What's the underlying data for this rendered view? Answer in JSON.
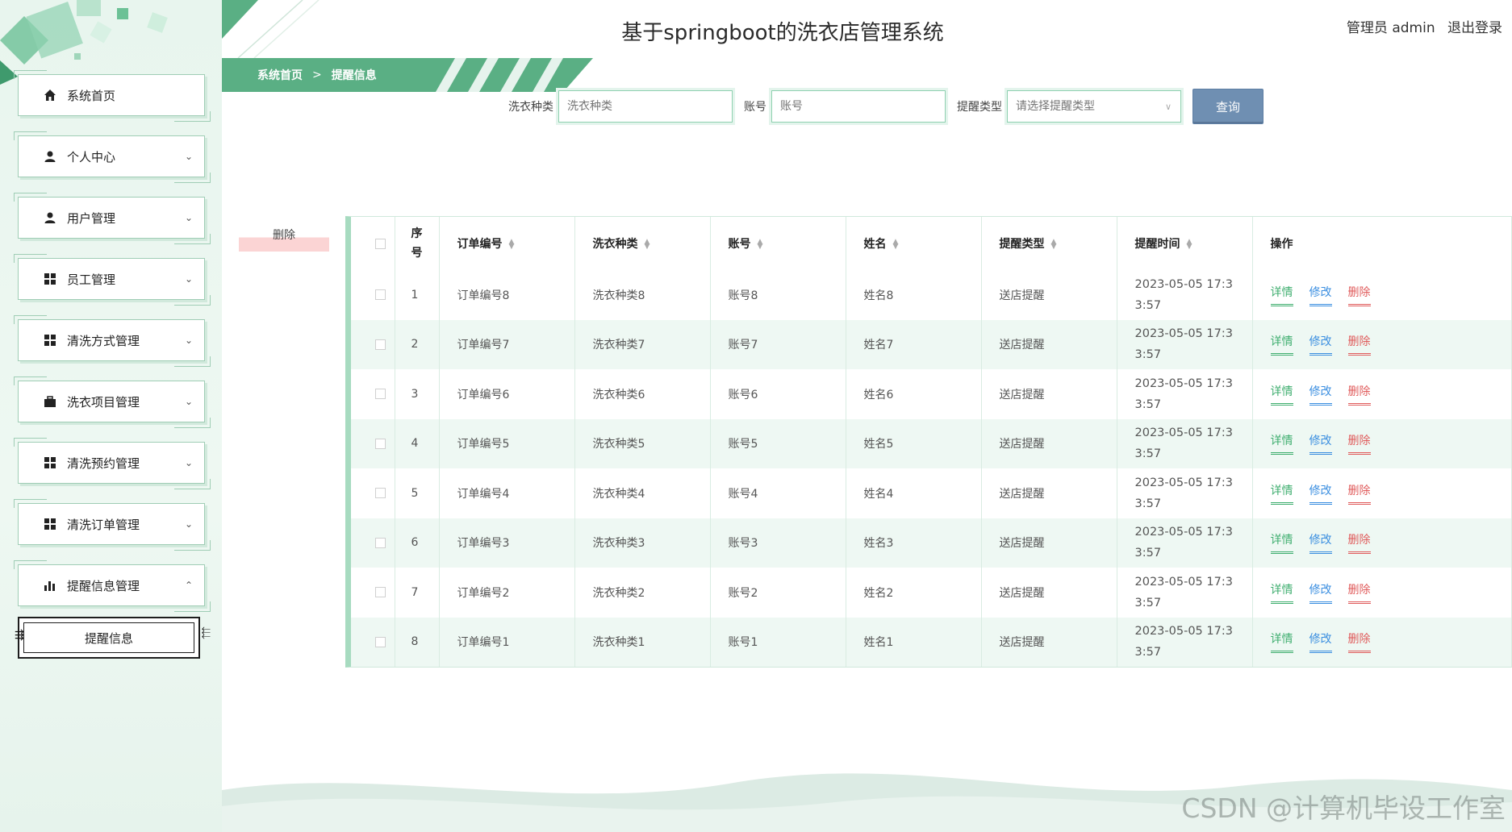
{
  "app": {
    "title": "基于springboot的洗衣店管理系统"
  },
  "header": {
    "user": "管理员 admin",
    "logout": "退出登录"
  },
  "breadcrumb": {
    "home": "系统首页",
    "separator": ">",
    "current": "提醒信息"
  },
  "sidebar": {
    "items": [
      {
        "label": "系统首页",
        "icon": "home-icon"
      },
      {
        "label": "个人中心",
        "icon": "user-icon",
        "chevron": "⌄"
      },
      {
        "label": "用户管理",
        "icon": "user-icon",
        "chevron": "⌄"
      },
      {
        "label": "员工管理",
        "icon": "grid-icon",
        "chevron": "⌄"
      },
      {
        "label": "清洗方式管理",
        "icon": "grid-icon",
        "chevron": "⌄"
      },
      {
        "label": "洗衣项目管理",
        "icon": "briefcase-icon",
        "chevron": "⌄"
      },
      {
        "label": "清洗预约管理",
        "icon": "grid-icon",
        "chevron": "⌄"
      },
      {
        "label": "清洗订单管理",
        "icon": "grid-icon",
        "chevron": "⌄"
      },
      {
        "label": "提醒信息管理",
        "icon": "bar-chart-icon",
        "chevron": "⌃"
      }
    ],
    "sub_item": {
      "label": "提醒信息"
    }
  },
  "search": {
    "laundry_type_label": "洗衣种类",
    "laundry_type_placeholder": "洗衣种类",
    "account_label": "账号",
    "account_placeholder": "账号",
    "reminder_type_label": "提醒类型",
    "reminder_type_placeholder": "请选择提醒类型",
    "query_button": "查询"
  },
  "actions": {
    "delete_button": "删除"
  },
  "table": {
    "headers": {
      "index": "序号",
      "order_no": "订单编号",
      "laundry_type": "洗衣种类",
      "account": "账号",
      "name": "姓名",
      "reminder_type": "提醒类型",
      "reminder_time": "提醒时间",
      "operation": "操作"
    },
    "op_labels": {
      "detail": "详情",
      "edit": "修改",
      "delete": "删除"
    },
    "rows": [
      {
        "index": "1",
        "order_no": "订单编号8",
        "laundry_type": "洗衣种类8",
        "account": "账号8",
        "name": "姓名8",
        "reminder_type": "送店提醒",
        "time_line1": "2023-05-05 17:3",
        "time_line2": "3:57"
      },
      {
        "index": "2",
        "order_no": "订单编号7",
        "laundry_type": "洗衣种类7",
        "account": "账号7",
        "name": "姓名7",
        "reminder_type": "送店提醒",
        "time_line1": "2023-05-05 17:3",
        "time_line2": "3:57"
      },
      {
        "index": "3",
        "order_no": "订单编号6",
        "laundry_type": "洗衣种类6",
        "account": "账号6",
        "name": "姓名6",
        "reminder_type": "送店提醒",
        "time_line1": "2023-05-05 17:3",
        "time_line2": "3:57"
      },
      {
        "index": "4",
        "order_no": "订单编号5",
        "laundry_type": "洗衣种类5",
        "account": "账号5",
        "name": "姓名5",
        "reminder_type": "送店提醒",
        "time_line1": "2023-05-05 17:3",
        "time_line2": "3:57"
      },
      {
        "index": "5",
        "order_no": "订单编号4",
        "laundry_type": "洗衣种类4",
        "account": "账号4",
        "name": "姓名4",
        "reminder_type": "送店提醒",
        "time_line1": "2023-05-05 17:3",
        "time_line2": "3:57"
      },
      {
        "index": "6",
        "order_no": "订单编号3",
        "laundry_type": "洗衣种类3",
        "account": "账号3",
        "name": "姓名3",
        "reminder_type": "送店提醒",
        "time_line1": "2023-05-05 17:3",
        "time_line2": "3:57"
      },
      {
        "index": "7",
        "order_no": "订单编号2",
        "laundry_type": "洗衣种类2",
        "account": "账号2",
        "name": "姓名2",
        "reminder_type": "送店提醒",
        "time_line1": "2023-05-05 17:3",
        "time_line2": "3:57"
      },
      {
        "index": "8",
        "order_no": "订单编号1",
        "laundry_type": "洗衣种类1",
        "account": "账号1",
        "name": "姓名1",
        "reminder_type": "送店提醒",
        "time_line1": "2023-05-05 17:3",
        "time_line2": "3:57"
      }
    ]
  },
  "watermark": "CSDN @计算机毕设工作室",
  "colors": {
    "accent_green": "#5aaf84",
    "query_button": "#6f8fb2",
    "detail": "#3fae6f",
    "edit": "#3a8ee0",
    "delete": "#e05c5c"
  }
}
